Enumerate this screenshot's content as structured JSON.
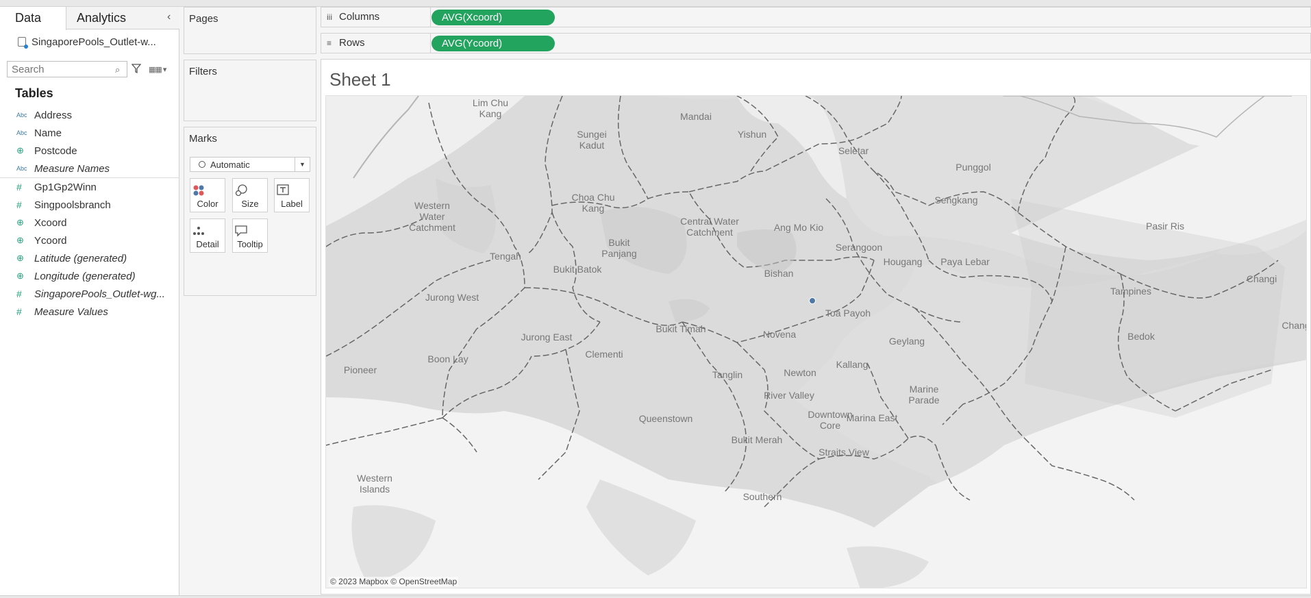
{
  "left_pane": {
    "tab_data": "Data",
    "tab_analytics": "Analytics",
    "collapse": "‹",
    "datasource": "SingaporePools_Outlet-w...",
    "search_placeholder": "Search",
    "tables_label": "Tables",
    "dimensions": [
      {
        "type": "Abc",
        "label": "Address"
      },
      {
        "type": "Abc",
        "label": "Name"
      },
      {
        "type": "globe",
        "label": "Postcode"
      },
      {
        "type": "Abc",
        "label": "Measure Names"
      }
    ],
    "measures": [
      {
        "type": "#",
        "label": "Gp1Gp2Winn"
      },
      {
        "type": "#",
        "label": "Singpoolsbranch"
      },
      {
        "type": "globe",
        "label": "Xcoord"
      },
      {
        "type": "globe",
        "label": "Ycoord"
      },
      {
        "type": "globe",
        "label": "Latitude (generated)"
      },
      {
        "type": "globe",
        "label": "Longitude (generated)"
      },
      {
        "type": "#",
        "label": "SingaporePools_Outlet-wg..."
      },
      {
        "type": "#",
        "label": "Measure Values"
      }
    ]
  },
  "cards": {
    "pages": "Pages",
    "filters": "Filters",
    "marks": "Marks",
    "mark_type": "Automatic",
    "buttons": {
      "color": "Color",
      "size": "Size",
      "label": "Label",
      "detail": "Detail",
      "tooltip": "Tooltip"
    }
  },
  "shelves": {
    "columns_label": "Columns",
    "columns_pill": "AVG(Xcoord)",
    "rows_label": "Rows",
    "rows_pill": "AVG(Ycoord)"
  },
  "sheet": {
    "title": "Sheet 1",
    "attribution": "© 2023 Mapbox © OpenStreetMap",
    "place_labels": [
      {
        "key": "lim",
        "text": "Lim Chu\nKang"
      },
      {
        "key": "mandai",
        "text": "Mandai"
      },
      {
        "key": "yishun",
        "text": "Yishun"
      },
      {
        "key": "sungei",
        "text": "Sungei\nKadut"
      },
      {
        "key": "seletar",
        "text": "Seletar"
      },
      {
        "key": "punggol",
        "text": "Punggol"
      },
      {
        "key": "choa",
        "text": "Choa Chu\nKang"
      },
      {
        "key": "sengkang",
        "text": "Sengkang"
      },
      {
        "key": "western",
        "text": "Western\nWater\nCatchment"
      },
      {
        "key": "central",
        "text": "Central Water\nCatchment"
      },
      {
        "key": "amk",
        "text": "Ang Mo Kio"
      },
      {
        "key": "pasir",
        "text": "Pasir Ris"
      },
      {
        "key": "serangoon",
        "text": "Serangoon"
      },
      {
        "key": "bukitpanjang",
        "text": "Bukit\nPanjang"
      },
      {
        "key": "tengah",
        "text": "Tengah"
      },
      {
        "key": "hougang",
        "text": "Hougang"
      },
      {
        "key": "paya",
        "text": "Paya Lebar"
      },
      {
        "key": "bukitbatok",
        "text": "Bukit Batok"
      },
      {
        "key": "bishan",
        "text": "Bishan"
      },
      {
        "key": "changi",
        "text": "Changi"
      },
      {
        "key": "tampines",
        "text": "Tampines"
      },
      {
        "key": "jurongwest",
        "text": "Jurong West"
      },
      {
        "key": "toapayoh",
        "text": "Toa Payoh"
      },
      {
        "key": "chang",
        "text": "Chang"
      },
      {
        "key": "bukittimah",
        "text": "Bukit Timah"
      },
      {
        "key": "novena",
        "text": "Novena"
      },
      {
        "key": "bedok",
        "text": "Bedok"
      },
      {
        "key": "jurongeast",
        "text": "Jurong East"
      },
      {
        "key": "geylang",
        "text": "Geylang"
      },
      {
        "key": "clementi",
        "text": "Clementi"
      },
      {
        "key": "boonlay",
        "text": "Boon Lay"
      },
      {
        "key": "kallang",
        "text": "Kallang"
      },
      {
        "key": "pioneer",
        "text": "Pioneer"
      },
      {
        "key": "newton",
        "text": "Newton"
      },
      {
        "key": "tanglin",
        "text": "Tanglin"
      },
      {
        "key": "marine",
        "text": "Marine\nParade"
      },
      {
        "key": "river",
        "text": "River Valley"
      },
      {
        "key": "downtown",
        "text": "Downtown\nCore"
      },
      {
        "key": "marineeast",
        "text": "Marina East"
      },
      {
        "key": "queenstown",
        "text": "Queenstown"
      },
      {
        "key": "bukitmerah",
        "text": "Bukit Merah"
      },
      {
        "key": "straits",
        "text": "Straits View"
      },
      {
        "key": "westernislands",
        "text": "Western\nIslands"
      },
      {
        "key": "southern",
        "text": "Southern"
      }
    ]
  }
}
